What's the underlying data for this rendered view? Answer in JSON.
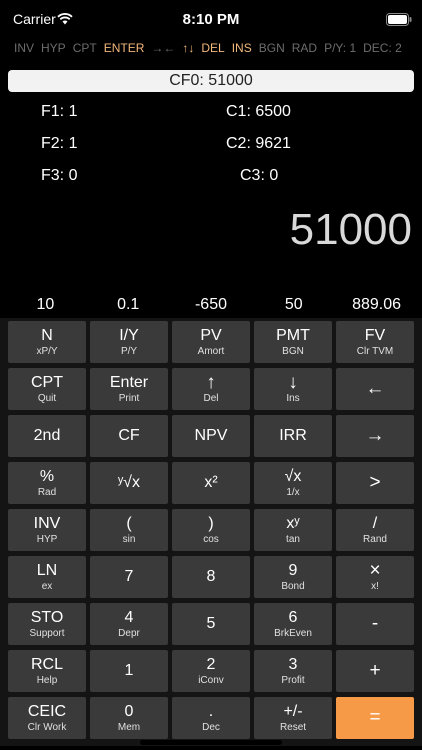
{
  "status": {
    "carrier": "Carrier",
    "time": "8:10 PM"
  },
  "indicators": [
    {
      "label": "INV",
      "on": false
    },
    {
      "label": "HYP",
      "on": false
    },
    {
      "label": "CPT",
      "on": false
    },
    {
      "label": "ENTER",
      "on": true
    },
    {
      "label": "→←",
      "on": false
    },
    {
      "label": "↑↓",
      "on": true
    },
    {
      "label": "DEL",
      "on": true
    },
    {
      "label": "INS",
      "on": true
    },
    {
      "label": "BGN",
      "on": false
    },
    {
      "label": "RAD",
      "on": false
    },
    {
      "label": "P/Y: 1",
      "on": false
    },
    {
      "label": "DEC: 2",
      "on": false
    }
  ],
  "cf_bar": "CF0: 51000",
  "registers": {
    "f1": "F1: 1",
    "f2": "F2: 1",
    "f3": "F3: 0",
    "c1": "C1: 6500",
    "c2": "C2: 9621",
    "c3": "C3: 0"
  },
  "display": "51000",
  "memory": [
    "10",
    "0.1",
    "-650",
    "50",
    "889.06"
  ],
  "keys": [
    [
      {
        "p": "N",
        "s": "xP/Y"
      },
      {
        "p": "I/Y",
        "s": "P/Y"
      },
      {
        "p": "PV",
        "s": "Amort"
      },
      {
        "p": "PMT",
        "s": "BGN"
      },
      {
        "p": "FV",
        "s": "Clr TVM"
      }
    ],
    [
      {
        "p": "CPT",
        "s": "Quit"
      },
      {
        "p": "Enter",
        "s": "Print"
      },
      {
        "p": "↑",
        "s": "Del"
      },
      {
        "p": "↓",
        "s": "Ins"
      },
      {
        "p": "←",
        "s": ""
      }
    ],
    [
      {
        "p": "2nd",
        "s": ""
      },
      {
        "p": "CF",
        "s": ""
      },
      {
        "p": "NPV",
        "s": ""
      },
      {
        "p": "IRR",
        "s": ""
      },
      {
        "p": "→",
        "s": ""
      }
    ],
    [
      {
        "p": "%",
        "s": "Rad"
      },
      {
        "p": "ʸ√x",
        "s": ""
      },
      {
        "p": "x²",
        "s": ""
      },
      {
        "p": "√x",
        "s": "1/x"
      },
      {
        "p": ">",
        "s": ""
      }
    ],
    [
      {
        "p": "INV",
        "s": "HYP"
      },
      {
        "p": "(",
        "s": "sin"
      },
      {
        "p": ")",
        "s": "cos"
      },
      {
        "p": "xʸ",
        "s": "tan"
      },
      {
        "p": "/",
        "s": "Rand"
      }
    ],
    [
      {
        "p": "LN",
        "s": "ex"
      },
      {
        "p": "7",
        "s": ""
      },
      {
        "p": "8",
        "s": ""
      },
      {
        "p": "9",
        "s": "Bond"
      },
      {
        "p": "×",
        "s": "x!"
      }
    ],
    [
      {
        "p": "STO",
        "s": "Support"
      },
      {
        "p": "4",
        "s": "Depr"
      },
      {
        "p": "5",
        "s": ""
      },
      {
        "p": "6",
        "s": "BrkEven"
      },
      {
        "p": "-",
        "s": ""
      }
    ],
    [
      {
        "p": "RCL",
        "s": "Help"
      },
      {
        "p": "1",
        "s": ""
      },
      {
        "p": "2",
        "s": "iConv"
      },
      {
        "p": "3",
        "s": "Profit"
      },
      {
        "p": "+",
        "s": ""
      }
    ],
    [
      {
        "p": "CEIC",
        "s": "Clr Work"
      },
      {
        "p": "0",
        "s": "Mem"
      },
      {
        "p": ".",
        "s": "Dec"
      },
      {
        "p": "+/-",
        "s": "Reset"
      },
      {
        "p": "=",
        "s": ""
      }
    ]
  ],
  "colors": {
    "accent": "#f69a47",
    "indicator_on": "#f4b97c",
    "key": "#3a3a3a"
  }
}
